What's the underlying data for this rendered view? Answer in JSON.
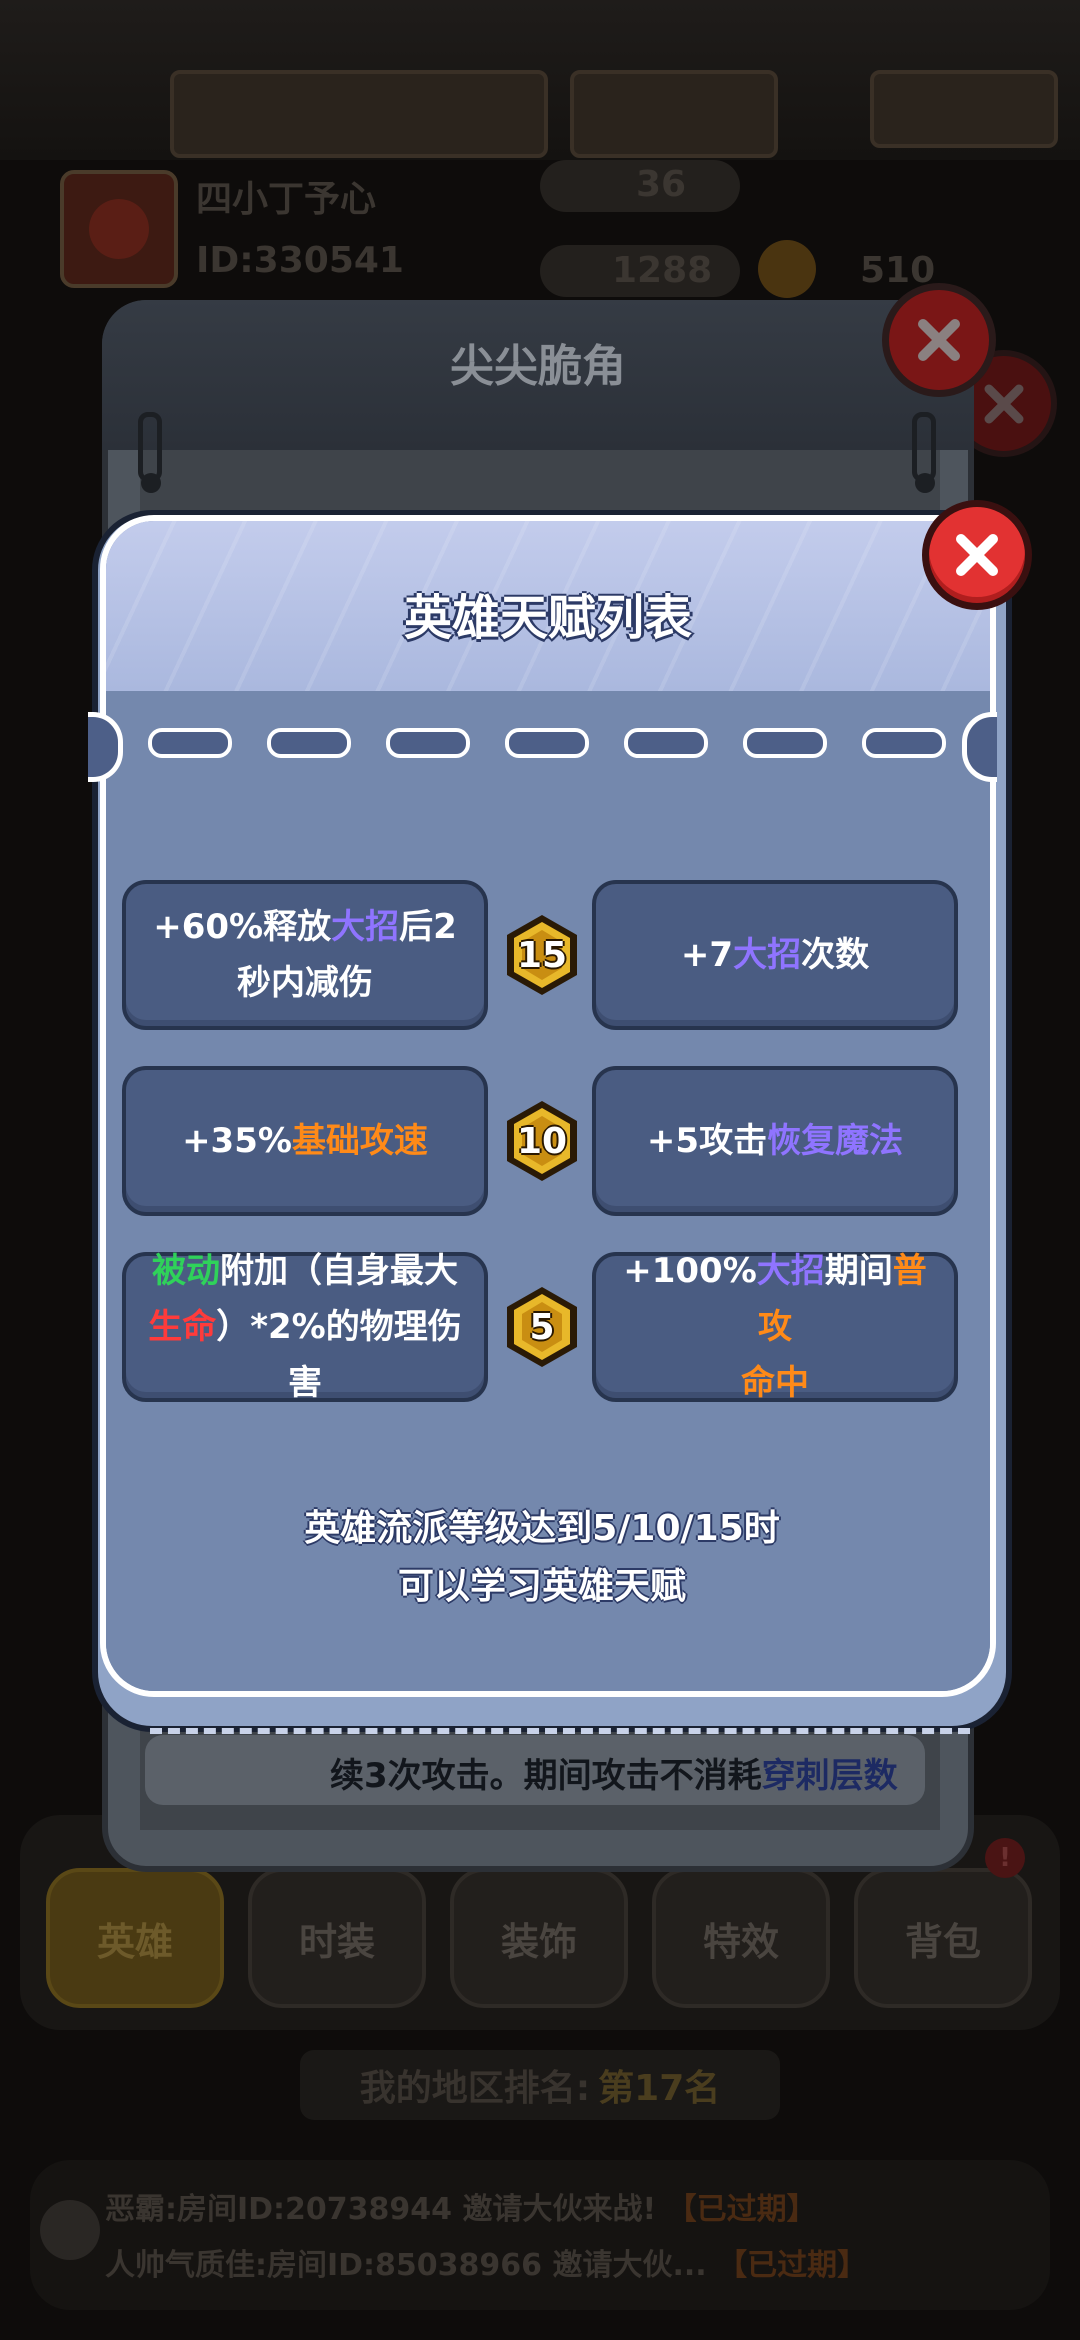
{
  "background": {
    "player_name": "四小丁予心",
    "player_id": "ID:330541",
    "level_value": "36",
    "gems": "1288",
    "coins": "510",
    "rank_label": "我的地区排名:",
    "rank_value": "第17名",
    "tabs": [
      {
        "label": "英雄"
      },
      {
        "label": "时装"
      },
      {
        "label": "装饰"
      },
      {
        "label": "特效"
      },
      {
        "label": "背包"
      }
    ],
    "tab_badge": "!",
    "chat": [
      {
        "text": "恶霸:房间ID:20738944 邀请大伙来战!",
        "status": "【已过期】"
      },
      {
        "text": "人帅气质佳:房间ID:85038966 邀请大伙...",
        "status": "【已过期】"
      }
    ]
  },
  "middle_modal": {
    "title": "尖尖脆角",
    "snippet_prefix": "续3次攻击。期间攻击不消耗",
    "snippet_keyword": "穿刺层数"
  },
  "talent_modal": {
    "title": "英雄天赋列表",
    "rows": [
      {
        "level": "15",
        "left": {
          "pre": "+60%释放",
          "kw": "大招",
          "post": "后2",
          "line2": "秒内减伤"
        },
        "right": {
          "pre": "+7",
          "kw": "大招",
          "post": "次数"
        }
      },
      {
        "level": "10",
        "left": {
          "pre": "+35%",
          "kw": "基础攻速"
        },
        "right": {
          "pre": "+5攻击",
          "kw": "恢复魔法"
        }
      },
      {
        "level": "5",
        "left": {
          "kw1": "被动",
          "mid": "附加（自身最大",
          "kw2": "生命",
          "post": "）*2%的物理伤",
          "line3": "害"
        },
        "right": {
          "pre": "+100%",
          "kw1": "大招",
          "mid": "期间",
          "kw2": "普攻",
          "kw3": "命中"
        }
      }
    ],
    "description_line1": "英雄流派等级达到5/10/15时",
    "description_line2": "可以学习英雄天赋"
  },
  "colors": {
    "keyword_purple": "#8f74ff",
    "keyword_orange": "#ff8a18",
    "keyword_green": "#2fd25a",
    "keyword_red": "#ff3b3b",
    "close_red": "#e23232",
    "badge_gold": "#e8b82a"
  }
}
